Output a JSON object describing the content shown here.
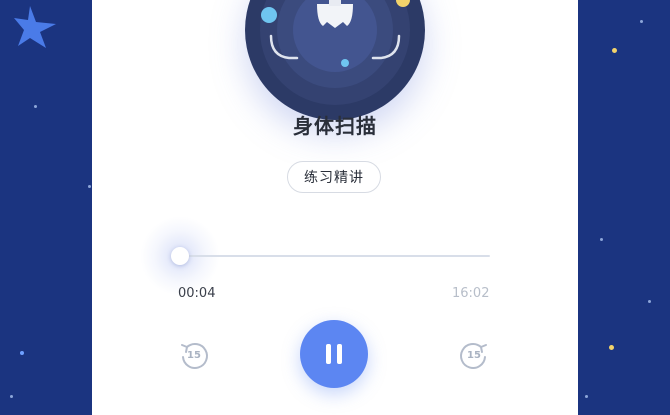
{
  "track": {
    "title": "身体扫描",
    "tag": "练习精讲"
  },
  "player": {
    "current_time": "00:04",
    "total_time": "16:02",
    "progress_fraction": 0.004,
    "skip_back_label": "15",
    "skip_forward_label": "15",
    "state": "playing"
  },
  "colors": {
    "background": "#1b3480",
    "accent": "#5c86f2",
    "card": "#ffffff"
  },
  "icons": {
    "background_star": "star-icon",
    "pause": "pause-icon",
    "skip_back": "replay-15-icon",
    "skip_forward": "forward-15-icon"
  }
}
